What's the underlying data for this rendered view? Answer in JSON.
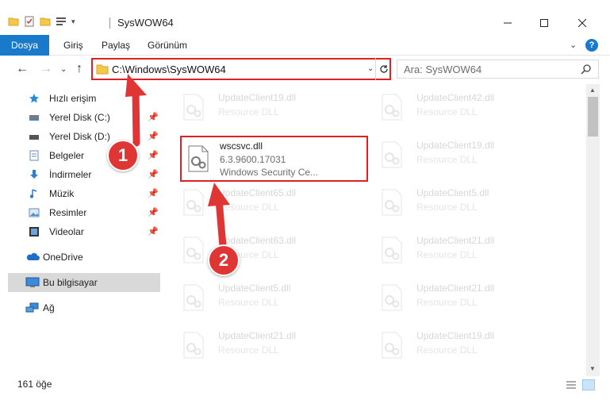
{
  "window": {
    "title": "SysWOW64"
  },
  "ribbon": {
    "tabs": [
      "Dosya",
      "Giriş",
      "Paylaş",
      "Görünüm"
    ]
  },
  "address": {
    "path": "C:\\Windows\\SysWOW64",
    "search_placeholder": "Ara: SysWOW64"
  },
  "sidebar": {
    "items": [
      {
        "label": "Hızlı erişim",
        "icon": "star-icon"
      },
      {
        "label": "Yerel Disk (C:)",
        "icon": "drive-icon"
      },
      {
        "label": "Yerel Disk (D:)",
        "icon": "drive-icon"
      },
      {
        "label": "Belgeler",
        "icon": "documents-icon"
      },
      {
        "label": "İndirmeler",
        "icon": "download-icon"
      },
      {
        "label": "Müzik",
        "icon": "music-icon"
      },
      {
        "label": "Resimler",
        "icon": "pictures-icon"
      },
      {
        "label": "Videolar",
        "icon": "videos-icon"
      },
      {
        "label": "OneDrive",
        "icon": "cloud-icon"
      },
      {
        "label": "Bu bilgisayar",
        "icon": "computer-icon"
      },
      {
        "label": "Ağ",
        "icon": "network-icon"
      }
    ]
  },
  "files": {
    "left": [
      {
        "name": "UpdateClient19.dll",
        "type": "Resource DLL"
      },
      {
        "name": "UpdateClient65.dll",
        "type": "Resource DLL"
      },
      {
        "name": "UpdateClient63.dll",
        "type": "Resource DLL"
      },
      {
        "name": "UpdateClient5.dll",
        "type": "Resource DLL"
      },
      {
        "name": "UpdateClient21.dll",
        "type": "Resource DLL"
      }
    ],
    "right": [
      {
        "name": "UpdateClient42.dll",
        "type": "Resource DLL"
      },
      {
        "name": "UpdateClient19.dll",
        "type": "Resource DLL"
      },
      {
        "name": "UpdateClient5.dll",
        "type": "Resource DLL"
      },
      {
        "name": "UpdateClient21.dll",
        "type": "Resource DLL"
      },
      {
        "name": "UpdateClient21.dll",
        "type": "Resource DLL"
      },
      {
        "name": "UpdateClient19.dll",
        "type": "Resource DLL"
      }
    ],
    "highlighted": {
      "name": "wscsvc.dll",
      "version": "6.3.9600.17031",
      "description": "Windows Security Ce..."
    }
  },
  "status": {
    "count": "161 öğe"
  },
  "annotations": {
    "step1": "1",
    "step2": "2"
  },
  "colors": {
    "accent": "#1979ca",
    "annotation": "#e03535"
  }
}
